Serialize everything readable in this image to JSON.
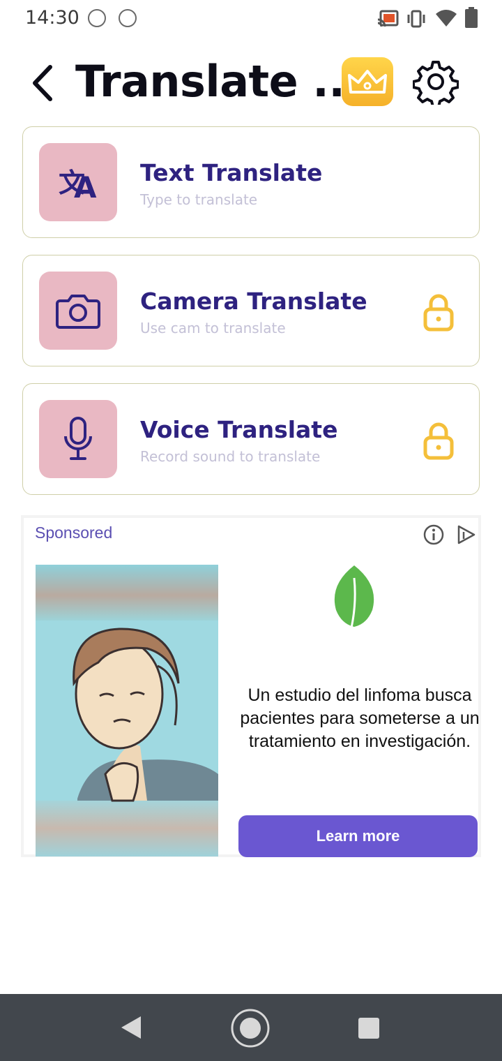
{
  "status_bar": {
    "time": "14:30",
    "icons": [
      "app-notification-icon",
      "app-notification-icon",
      "cast-icon",
      "vibrate-icon",
      "wifi-icon",
      "battery-icon"
    ]
  },
  "header": {
    "title": "Translate ...",
    "icons": [
      "back-arrow-icon",
      "crown-icon",
      "gear-icon"
    ]
  },
  "features": [
    {
      "title": "Text Translate",
      "subtitle": "Type to translate",
      "icon": "translate-icon",
      "locked": false
    },
    {
      "title": "Camera Translate",
      "subtitle": "Use cam to translate",
      "icon": "camera-icon",
      "locked": true
    },
    {
      "title": "Voice Translate",
      "subtitle": "Record sound to translate",
      "icon": "microphone-icon",
      "locked": true
    }
  ],
  "ad": {
    "label": "Sponsored",
    "body": "Un estudio del linfoma busca pacientes para someterse a un tratamiento en investigación.",
    "cta": "Learn more",
    "icons": [
      "info-icon",
      "adchoices-icon",
      "leaf-icon"
    ]
  },
  "nav_bar": {
    "icons": [
      "nav-back-icon",
      "nav-home-icon",
      "nav-recents-icon"
    ]
  },
  "colors": {
    "accent_purple": "#2e2280",
    "icon_tile": "#e9b8c3",
    "premium_gold": "#f5b12a",
    "lock_gold": "#f4bf3a",
    "cta_purple": "#6a57d1",
    "nav_bar": "#42474d"
  }
}
